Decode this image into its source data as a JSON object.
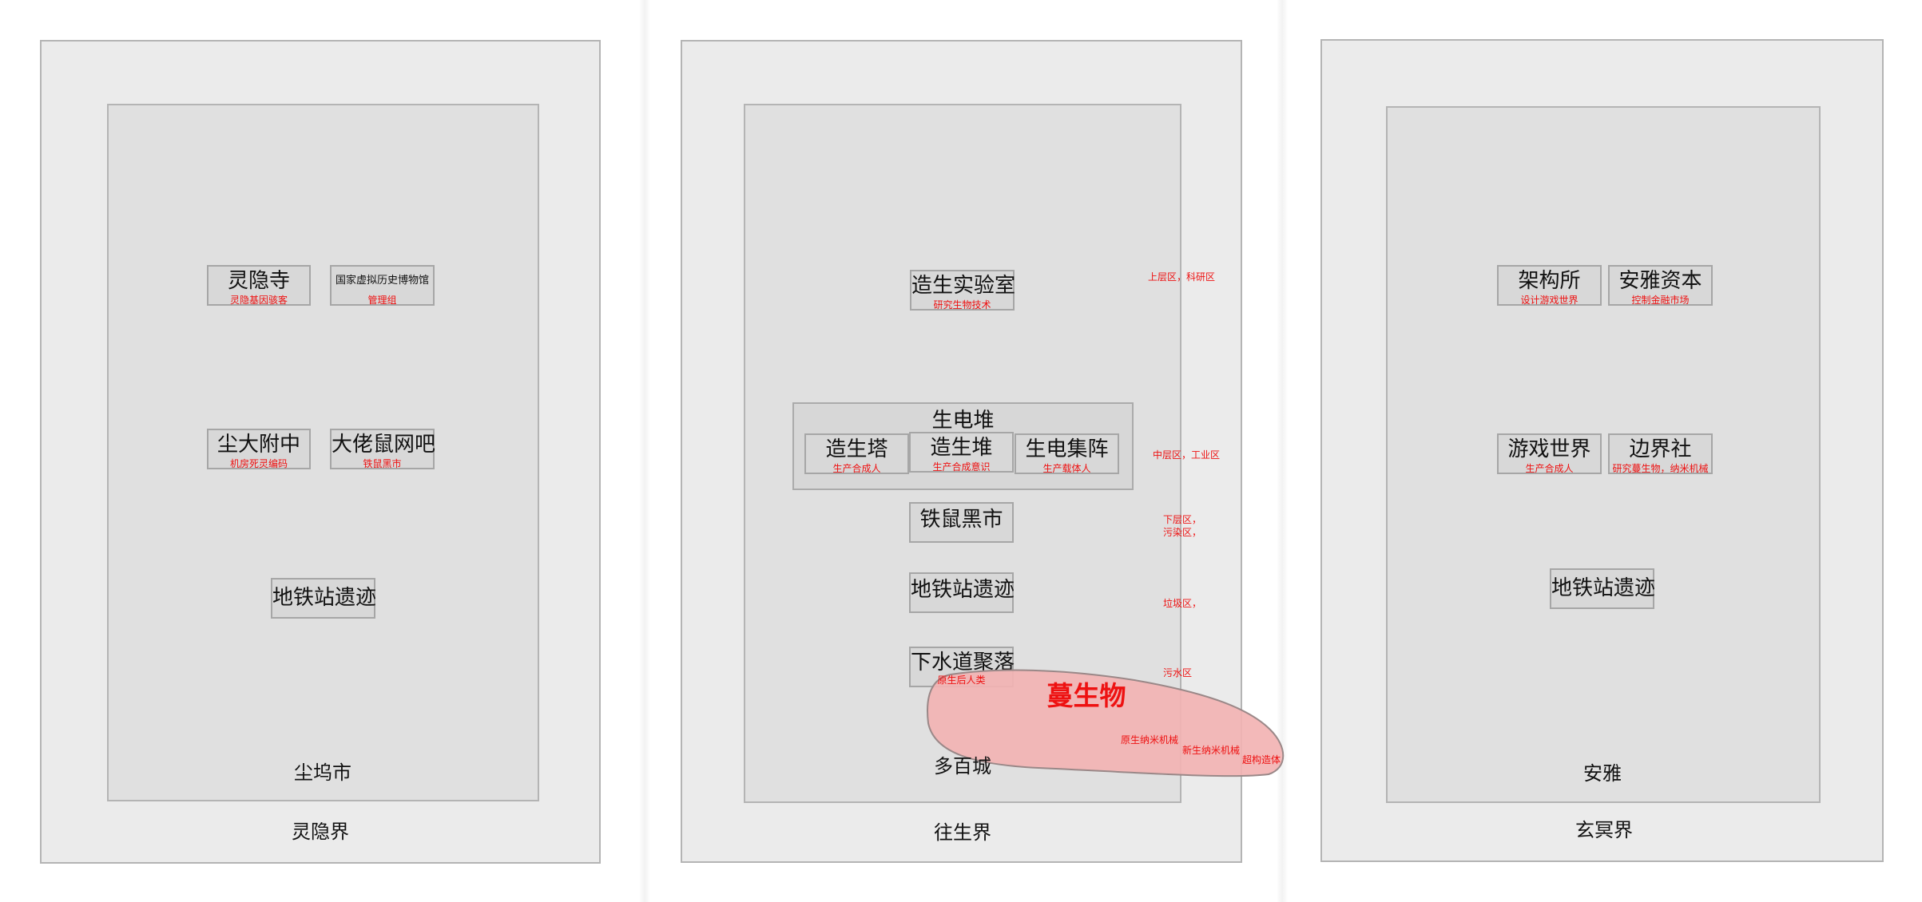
{
  "realms": [
    {
      "name": "灵隐界",
      "city": "尘坞市",
      "places": [
        {
          "name": "灵隐寺",
          "sub": "灵隐基因骇客"
        },
        {
          "name": "国家虚拟历史博物馆",
          "sub": "管理组"
        },
        {
          "name": "尘大附中",
          "sub": "机房死灵编码"
        },
        {
          "name": "大佬鼠网吧",
          "sub": "铁鼠黑市"
        },
        {
          "name": "地铁站遗迹",
          "sub": ""
        }
      ]
    },
    {
      "name": "往生界",
      "city": "多百城",
      "places": [
        {
          "name": "造生实验室",
          "sub": "研究生物技术"
        },
        {
          "name": "生电堆",
          "sub": ""
        },
        {
          "name": "造生塔",
          "sub": "生产合成人"
        },
        {
          "name": "造生堆",
          "sub": "生产合成意识"
        },
        {
          "name": "生电集阵",
          "sub": "生产载体人"
        },
        {
          "name": "铁鼠黑市",
          "sub": ""
        },
        {
          "name": "地铁站遗迹",
          "sub": ""
        },
        {
          "name": "下水道聚落",
          "sub": "原生后人类"
        }
      ],
      "zones": [
        "上层区，科研区",
        "中层区，工业区",
        "下层区，\n污染区，",
        "垃圾区，",
        "污水区"
      ],
      "vine": {
        "title": "蔓生物",
        "items": [
          "原生纳米机械",
          "新生纳米机械",
          "超构造体"
        ]
      }
    },
    {
      "name": "玄冥界",
      "city": "安雅",
      "places": [
        {
          "name": "架构所",
          "sub": "设计游戏世界"
        },
        {
          "name": "安雅资本",
          "sub": "控制金融市场"
        },
        {
          "name": "游戏世界",
          "sub": "生产合成人"
        },
        {
          "name": "边界社",
          "sub": "研究蔓生物，纳米机械"
        },
        {
          "name": "地铁站遗迹",
          "sub": ""
        }
      ]
    }
  ],
  "colors": {
    "annotation": "#ee1111",
    "vine_fill": "#f2b3b3",
    "vine_stroke": "#9a8888"
  }
}
